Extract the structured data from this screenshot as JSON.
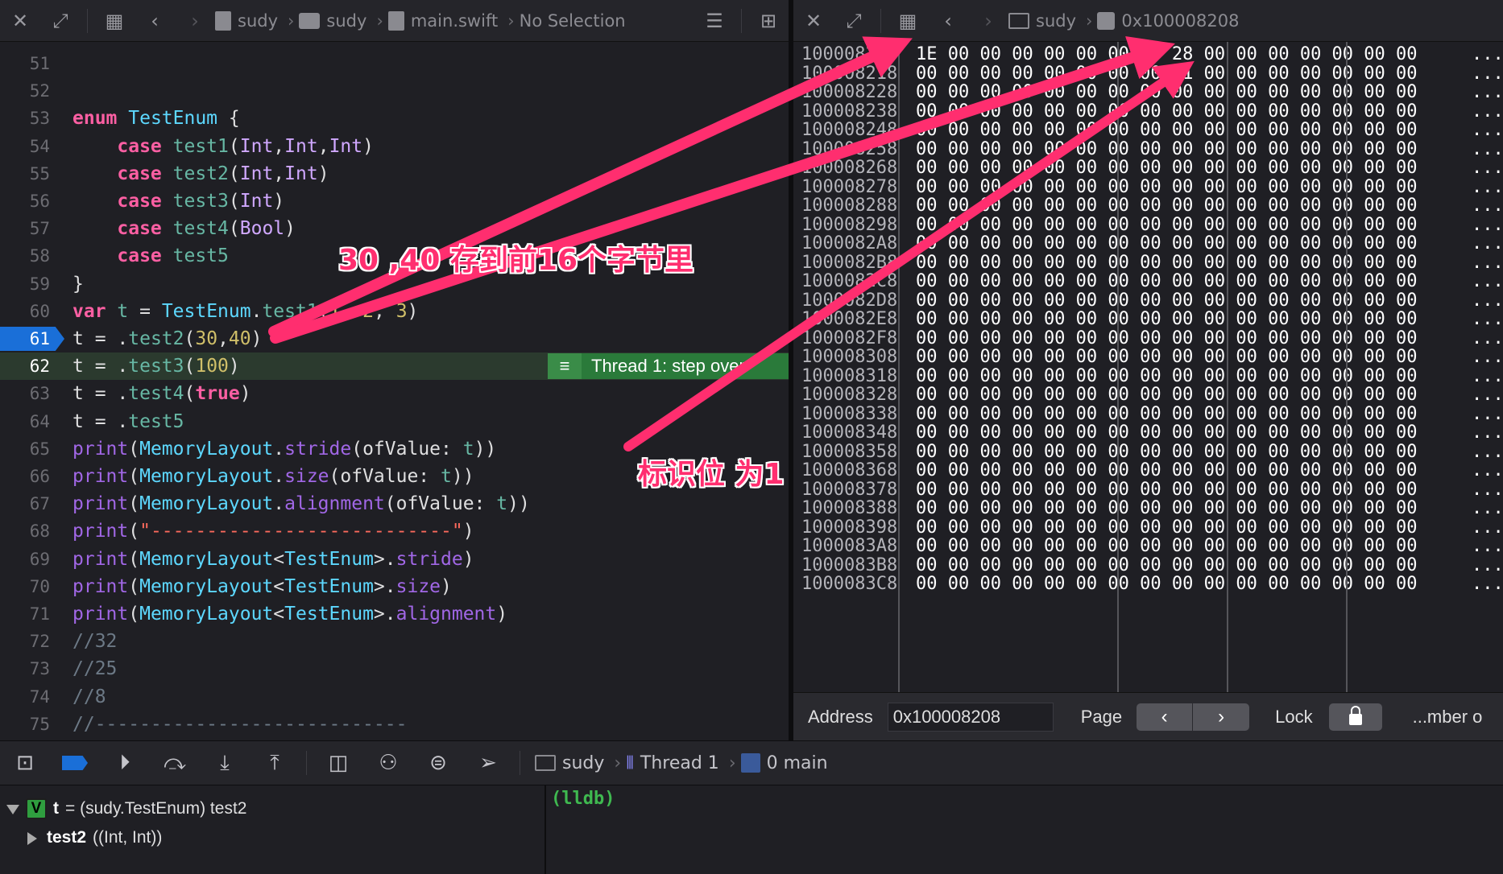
{
  "editor": {
    "breadcrumb": [
      "sudy",
      "sudy",
      "main.swift",
      "No Selection"
    ],
    "lines": [
      {
        "n": "51",
        "html": ""
      },
      {
        "n": "52",
        "html": ""
      },
      {
        "n": "53",
        "html": "<span class=\"kw\">enum</span> <span class=\"ty\">TestEnum</span> {"
      },
      {
        "n": "54",
        "html": "    <span class=\"kw\">case</span> <span class=\"fn\">test1</span>(<span class=\"ty2\">Int</span>,<span class=\"ty2\">Int</span>,<span class=\"ty2\">Int</span>)"
      },
      {
        "n": "55",
        "html": "    <span class=\"kw\">case</span> <span class=\"fn\">test2</span>(<span class=\"ty2\">Int</span>,<span class=\"ty2\">Int</span>)"
      },
      {
        "n": "56",
        "html": "    <span class=\"kw\">case</span> <span class=\"fn\">test3</span>(<span class=\"ty2\">Int</span>)"
      },
      {
        "n": "57",
        "html": "    <span class=\"kw\">case</span> <span class=\"fn\">test4</span>(<span class=\"ty2\">Bool</span>)"
      },
      {
        "n": "58",
        "html": "    <span class=\"kw\">case</span> <span class=\"fn\">test5</span>"
      },
      {
        "n": "59",
        "html": "}"
      },
      {
        "n": "60",
        "html": "<span class=\"kw\">var</span> <span class=\"fn\">t</span> = <span class=\"ty\">TestEnum</span>.<span class=\"fn\">test1</span>(<span class=\"num\">1</span>, <span class=\"num\">2</span>, <span class=\"num\">3</span>)"
      },
      {
        "n": "61",
        "html": "t = .<span class=\"fn\">test2</span>(<span class=\"num\">30</span>,<span class=\"num\">40</span>)",
        "breakpoint": true
      },
      {
        "n": "62",
        "html": "t = .<span class=\"fn\">test3</span>(<span class=\"num\">100</span>)",
        "current": true
      },
      {
        "n": "63",
        "html": "t = .<span class=\"fn\">test4</span>(<span class=\"kw\">true</span>)"
      },
      {
        "n": "64",
        "html": "t = .<span class=\"fn\">test5</span>"
      },
      {
        "n": "65",
        "html": "<span class=\"mem\">print</span>(<span class=\"ty\">MemoryLayout</span>.<span class=\"mem\">stride</span>(ofValue: <span class=\"fn\">t</span>))"
      },
      {
        "n": "66",
        "html": "<span class=\"mem\">print</span>(<span class=\"ty\">MemoryLayout</span>.<span class=\"mem\">size</span>(ofValue: <span class=\"fn\">t</span>))"
      },
      {
        "n": "67",
        "html": "<span class=\"mem\">print</span>(<span class=\"ty\">MemoryLayout</span>.<span class=\"mem\">alignment</span>(ofValue: <span class=\"fn\">t</span>))"
      },
      {
        "n": "68",
        "html": "<span class=\"mem\">print</span>(<span class=\"str\">\"---------------------------\"</span>)"
      },
      {
        "n": "69",
        "html": "<span class=\"mem\">print</span>(<span class=\"ty\">MemoryLayout</span>&lt;<span class=\"ty\">TestEnum</span>&gt;.<span class=\"mem\">stride</span>)"
      },
      {
        "n": "70",
        "html": "<span class=\"mem\">print</span>(<span class=\"ty\">MemoryLayout</span>&lt;<span class=\"ty\">TestEnum</span>&gt;.<span class=\"mem\">size</span>)"
      },
      {
        "n": "71",
        "html": "<span class=\"mem\">print</span>(<span class=\"ty\">MemoryLayout</span>&lt;<span class=\"ty\">TestEnum</span>&gt;.<span class=\"mem\">alignment</span>)"
      },
      {
        "n": "72",
        "html": "<span class=\"cm\">//32</span>"
      },
      {
        "n": "73",
        "html": "<span class=\"cm\">//25</span>"
      },
      {
        "n": "74",
        "html": "<span class=\"cm\">//8</span>"
      },
      {
        "n": "75",
        "html": "<span class=\"cm\">//----------------------------</span>"
      }
    ],
    "thread_badge": "Thread 1: step over"
  },
  "memory": {
    "breadcrumb_target": "sudy",
    "breadcrumb_address": "0x100008208",
    "rows": [
      {
        "addr": "100008208",
        "bytes": "1E 00 00 00 00 00 00 00  28 00 00 00 00 00 00 00"
      },
      {
        "addr": "100008218",
        "bytes": "00 00 00 00 00 00 00 00  01 00 00 00 00 00 00 00"
      },
      {
        "addr": "100008228",
        "bytes": "00 00 00 00 00 00 00 00  00 00 00 00 00 00 00 00"
      },
      {
        "addr": "100008238",
        "bytes": "00 00 00 00 00 00 00 00  00 00 00 00 00 00 00 00"
      },
      {
        "addr": "100008248",
        "bytes": "00 00 00 00 00 00 00 00  00 00 00 00 00 00 00 00"
      },
      {
        "addr": "100008258",
        "bytes": "00 00 00 00 00 00 00 00  00 00 00 00 00 00 00 00"
      },
      {
        "addr": "100008268",
        "bytes": "00 00 00 00 00 00 00 00  00 00 00 00 00 00 00 00"
      },
      {
        "addr": "100008278",
        "bytes": "00 00 00 00 00 00 00 00  00 00 00 00 00 00 00 00"
      },
      {
        "addr": "100008288",
        "bytes": "00 00 00 00 00 00 00 00  00 00 00 00 00 00 00 00"
      },
      {
        "addr": "100008298",
        "bytes": "00 00 00 00 00 00 00 00  00 00 00 00 00 00 00 00"
      },
      {
        "addr": "1000082A8",
        "bytes": "00 00 00 00 00 00 00 00  00 00 00 00 00 00 00 00"
      },
      {
        "addr": "1000082B8",
        "bytes": "00 00 00 00 00 00 00 00  00 00 00 00 00 00 00 00"
      },
      {
        "addr": "1000082C8",
        "bytes": "00 00 00 00 00 00 00 00  00 00 00 00 00 00 00 00"
      },
      {
        "addr": "1000082D8",
        "bytes": "00 00 00 00 00 00 00 00  00 00 00 00 00 00 00 00"
      },
      {
        "addr": "1000082E8",
        "bytes": "00 00 00 00 00 00 00 00  00 00 00 00 00 00 00 00"
      },
      {
        "addr": "1000082F8",
        "bytes": "00 00 00 00 00 00 00 00  00 00 00 00 00 00 00 00"
      },
      {
        "addr": "100008308",
        "bytes": "00 00 00 00 00 00 00 00  00 00 00 00 00 00 00 00"
      },
      {
        "addr": "100008318",
        "bytes": "00 00 00 00 00 00 00 00  00 00 00 00 00 00 00 00"
      },
      {
        "addr": "100008328",
        "bytes": "00 00 00 00 00 00 00 00  00 00 00 00 00 00 00 00"
      },
      {
        "addr": "100008338",
        "bytes": "00 00 00 00 00 00 00 00  00 00 00 00 00 00 00 00"
      },
      {
        "addr": "100008348",
        "bytes": "00 00 00 00 00 00 00 00  00 00 00 00 00 00 00 00"
      },
      {
        "addr": "100008358",
        "bytes": "00 00 00 00 00 00 00 00  00 00 00 00 00 00 00 00"
      },
      {
        "addr": "100008368",
        "bytes": "00 00 00 00 00 00 00 00  00 00 00 00 00 00 00 00"
      },
      {
        "addr": "100008378",
        "bytes": "00 00 00 00 00 00 00 00  00 00 00 00 00 00 00 00"
      },
      {
        "addr": "100008388",
        "bytes": "00 00 00 00 00 00 00 00  00 00 00 00 00 00 00 00"
      },
      {
        "addr": "100008398",
        "bytes": "00 00 00 00 00 00 00 00  00 00 00 00 00 00 00 00"
      },
      {
        "addr": "1000083A8",
        "bytes": "00 00 00 00 00 00 00 00  00 00 00 00 00 00 00 00"
      },
      {
        "addr": "1000083B8",
        "bytes": "00 00 00 00 00 00 00 00  00 00 00 00 00 00 00 00"
      },
      {
        "addr": "1000083C8",
        "bytes": "00 00 00 00 00 00 00 00  00 00 00 00 00 00 00 00"
      }
    ],
    "ascii": "...",
    "footer": {
      "address_label": "Address",
      "address_value": "0x100008208",
      "page_label": "Page",
      "lock_label": "Lock",
      "number_label": "...mber o"
    }
  },
  "debugbar": {
    "target": "sudy",
    "thread": "Thread 1",
    "frame": "0 main"
  },
  "variables": {
    "root_name": "t",
    "root_value": "= (sudy.TestEnum) test2",
    "root_badge": "V",
    "child_name": "test2",
    "child_value": "((Int, Int))"
  },
  "console": {
    "prompt": "(lldb)"
  },
  "annotations": {
    "note_first16": "30 ,40  存到前16个字节里",
    "note_flag": "标识位 为1",
    "color": "#ff2e6f"
  }
}
